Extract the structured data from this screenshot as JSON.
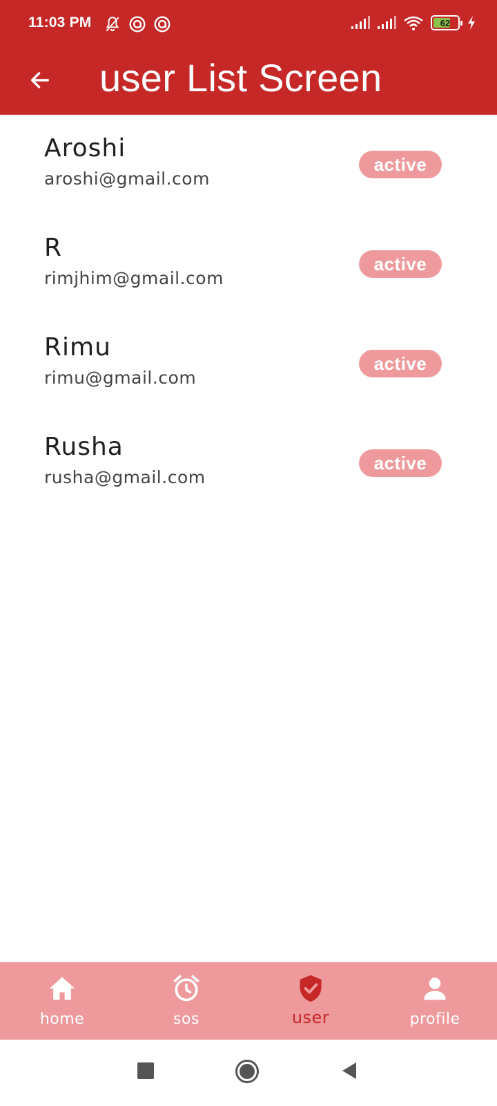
{
  "status_bar": {
    "time": "11:03 PM",
    "battery": "62",
    "icons": [
      "mute-bell-icon",
      "circle-a-icon",
      "circle-a-icon",
      "signal-icon",
      "signal-icon",
      "wifi-icon",
      "battery-icon",
      "charging-icon"
    ]
  },
  "app_bar": {
    "title": "user List Screen",
    "back_icon": "arrow-back-icon"
  },
  "users": [
    {
      "name": "Aroshi",
      "email": "aroshi@gmail.com",
      "status": "active"
    },
    {
      "name": "R",
      "email": "rimjhim@gmail.com",
      "status": "active"
    },
    {
      "name": "Rimu",
      "email": "rimu@gmail.com",
      "status": "active"
    },
    {
      "name": "Rusha",
      "email": "rusha@gmail.com",
      "status": "active"
    }
  ],
  "bottom_nav": {
    "items": [
      {
        "label": "home",
        "icon": "home-icon"
      },
      {
        "label": "sos",
        "icon": "alarm-clock-icon"
      },
      {
        "label": "user",
        "icon": "shield-check-icon",
        "active": true
      },
      {
        "label": "profile",
        "icon": "person-icon"
      }
    ]
  },
  "colors": {
    "primary": "#c62828",
    "nav_bg": "#ee9a9d",
    "badge_bg": "#ee9a9d"
  }
}
